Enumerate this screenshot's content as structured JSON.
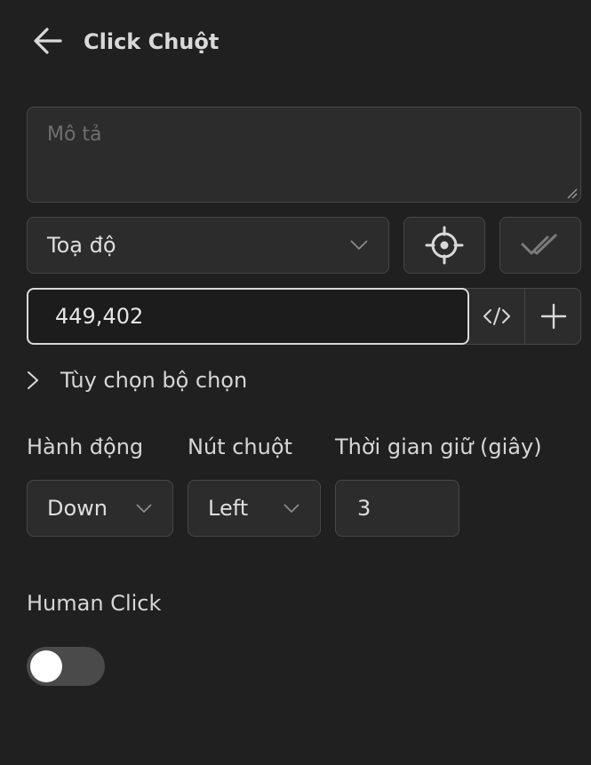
{
  "header": {
    "title": "Click Chuột"
  },
  "description": {
    "placeholder": "Mô tả",
    "value": ""
  },
  "coordinate": {
    "type_label": "Toạ độ",
    "value": "449,402"
  },
  "selector_options": {
    "label": "Tùy chọn bộ chọn"
  },
  "action": {
    "label": "Hành động",
    "value": "Down"
  },
  "mouse_button": {
    "label": "Nút chuột",
    "value": "Left"
  },
  "hold_time": {
    "label": "Thời gian giữ (giây)",
    "value": "3"
  },
  "human_click": {
    "label": "Human Click",
    "enabled": false
  },
  "colors": {
    "background": "#202020",
    "field": "#2c2c2c",
    "border": "#474747",
    "text": "#d6d6d6"
  }
}
